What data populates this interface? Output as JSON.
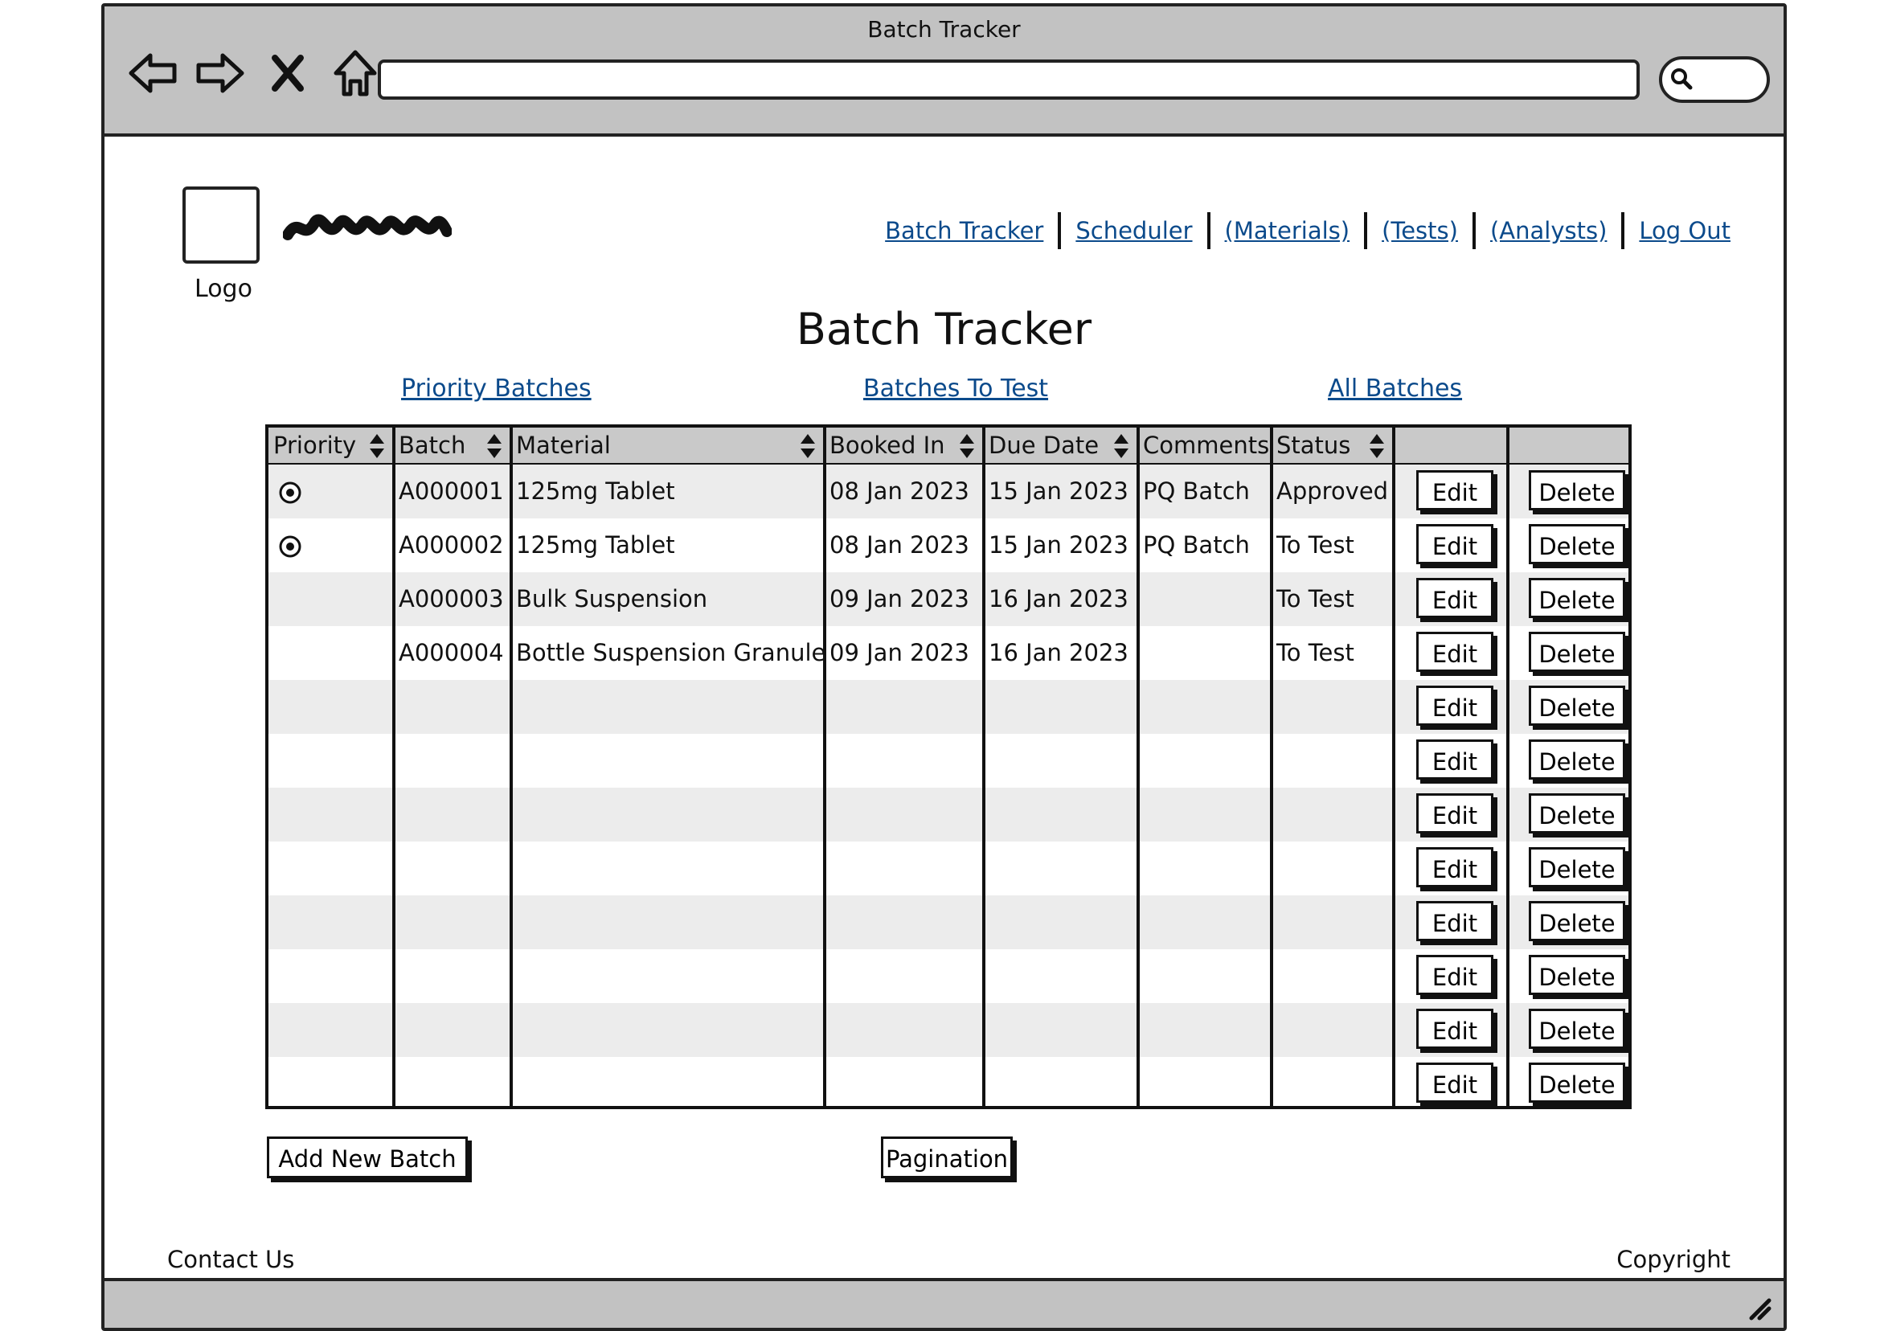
{
  "window": {
    "title": "Batch Tracker",
    "address": ""
  },
  "header": {
    "logo_label": "Logo",
    "nav": [
      "Batch Tracker",
      "Scheduler",
      "(Materials)",
      "(Tests)",
      "(Analysts)",
      "Log Out"
    ]
  },
  "page": {
    "title": "Batch Tracker",
    "subnav": {
      "priority": "Priority Batches",
      "to_test": "Batches To Test",
      "all": "All Batches"
    }
  },
  "table": {
    "columns": [
      "Priority",
      "Batch",
      "Material",
      "Booked In",
      "Due Date",
      "Comments",
      "Status"
    ],
    "edit_label": "Edit",
    "delete_label": "Delete",
    "rows": [
      {
        "priority": true,
        "batch": "A000001",
        "material": "125mg Tablet",
        "booked_in": "08 Jan 2023",
        "due_date": "15 Jan 2023",
        "comments": "PQ Batch",
        "status": "Approved"
      },
      {
        "priority": true,
        "batch": "A000002",
        "material": "125mg Tablet",
        "booked_in": "08 Jan 2023",
        "due_date": "15 Jan 2023",
        "comments": "PQ Batch",
        "status": "To Test"
      },
      {
        "priority": false,
        "batch": "A000003",
        "material": "Bulk Suspension",
        "booked_in": "09 Jan 2023",
        "due_date": "16 Jan 2023",
        "comments": "",
        "status": "To Test"
      },
      {
        "priority": false,
        "batch": "A000004",
        "material": "Bottle Suspension Granule",
        "booked_in": "09 Jan 2023",
        "due_date": "16 Jan 2023",
        "comments": "",
        "status": "To Test"
      },
      {
        "priority": false,
        "batch": "",
        "material": "",
        "booked_in": "",
        "due_date": "",
        "comments": "",
        "status": ""
      },
      {
        "priority": false,
        "batch": "",
        "material": "",
        "booked_in": "",
        "due_date": "",
        "comments": "",
        "status": ""
      },
      {
        "priority": false,
        "batch": "",
        "material": "",
        "booked_in": "",
        "due_date": "",
        "comments": "",
        "status": ""
      },
      {
        "priority": false,
        "batch": "",
        "material": "",
        "booked_in": "",
        "due_date": "",
        "comments": "",
        "status": ""
      },
      {
        "priority": false,
        "batch": "",
        "material": "",
        "booked_in": "",
        "due_date": "",
        "comments": "",
        "status": ""
      },
      {
        "priority": false,
        "batch": "",
        "material": "",
        "booked_in": "",
        "due_date": "",
        "comments": "",
        "status": ""
      },
      {
        "priority": false,
        "batch": "",
        "material": "",
        "booked_in": "",
        "due_date": "",
        "comments": "",
        "status": ""
      },
      {
        "priority": false,
        "batch": "",
        "material": "",
        "booked_in": "",
        "due_date": "",
        "comments": "",
        "status": ""
      }
    ]
  },
  "actions": {
    "add_new": "Add New Batch",
    "pagination": "Pagination"
  },
  "footer": {
    "contact": "Contact Us",
    "copyright": "Copyright"
  },
  "colors": {
    "link": "#0b4a8b",
    "chrome": "#c2c2c2",
    "row_alt": "#ececec"
  }
}
